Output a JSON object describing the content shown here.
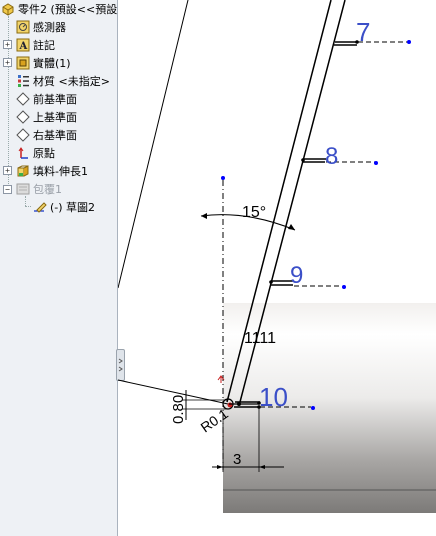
{
  "tree": {
    "root": {
      "label": "零件2  (預設<<預設"
    },
    "items": [
      {
        "label": "感測器",
        "icon": "sensor-icon"
      },
      {
        "label": "註記",
        "icon": "annotation-icon",
        "expandable": true
      },
      {
        "label": "實體(1)",
        "icon": "solid-body-icon",
        "expandable": true
      },
      {
        "label": "材質 <未指定>",
        "icon": "material-icon"
      },
      {
        "label": "前基準面",
        "icon": "plane-icon"
      },
      {
        "label": "上基準面",
        "icon": "plane-icon"
      },
      {
        "label": "右基準面",
        "icon": "plane-icon"
      },
      {
        "label": "原點",
        "icon": "origin-icon"
      },
      {
        "label": "填料-伸長1",
        "icon": "extrude-icon",
        "expandable": true
      },
      {
        "label": "包覆1",
        "icon": "wrap-icon",
        "expandable": true
      },
      {
        "label": "(-) 草圖2",
        "icon": "sketch-icon"
      }
    ]
  },
  "sketch": {
    "angle": "15°",
    "text_dim": "1111",
    "height_dim": "0.80",
    "radius_dim": "R0.1",
    "width_dim": "3",
    "balloons": [
      "7",
      "8",
      "9",
      "10"
    ],
    "colors": {
      "balloon": "#3b4fc8",
      "line": "#000000",
      "dim_dot": "#0000ff",
      "part": "#8a8a8a"
    }
  }
}
